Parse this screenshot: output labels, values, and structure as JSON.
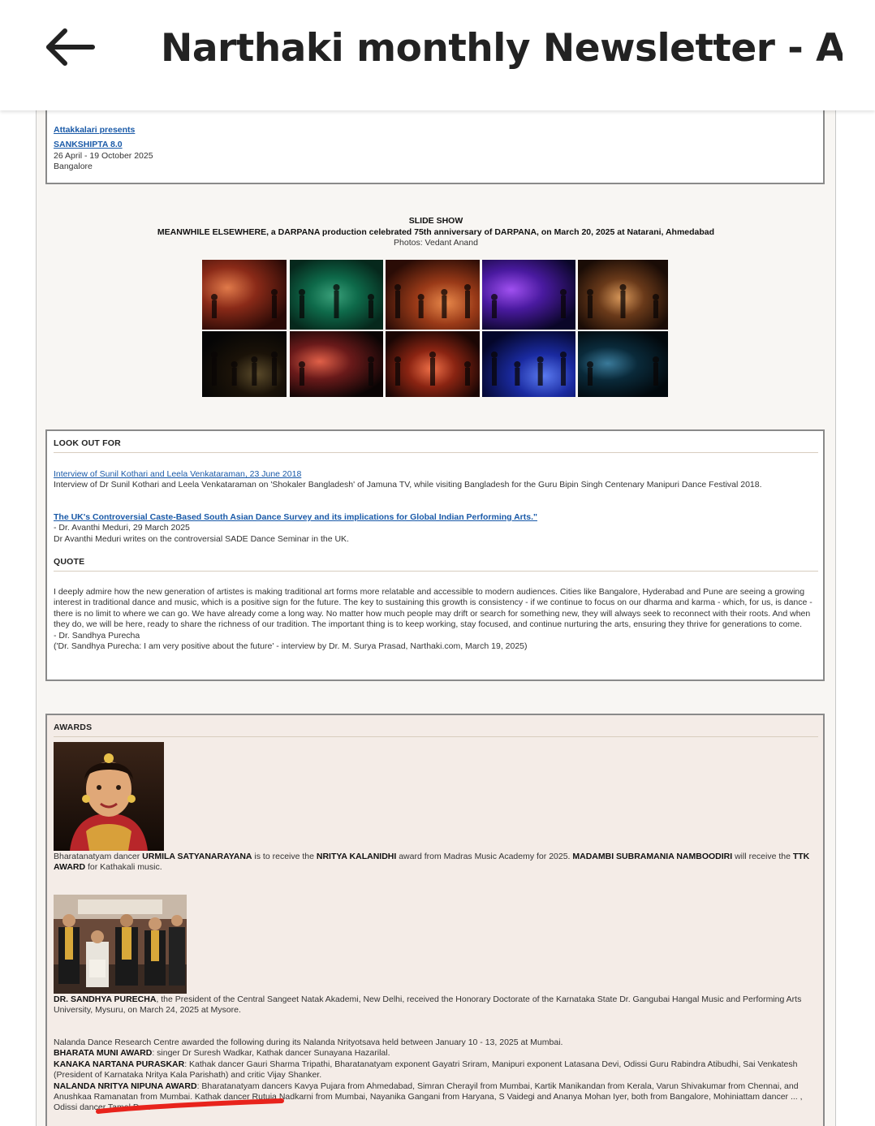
{
  "header": {
    "back_icon": "arrow-left-icon",
    "title": "Narthaki monthly Newsletter - Ap..."
  },
  "event": {
    "presenter": "Attakkalari presents",
    "name": "SANKSHIPTA 8.0",
    "dates": "26 April - 19 October 2025",
    "city": "Bangalore"
  },
  "slideshow": {
    "heading": "SLIDE SHOW",
    "caption": "MEANWHILE ELSEWHERE, a DARPANA production celebrated 75th anniversary of DARPANA, on March 20, 2025 at Natarani, Ahmedabad",
    "credit": "Photos: Vedant Anand",
    "photo_count": 10,
    "photo_palettes": [
      [
        "#2a0a06",
        "#8a2a18",
        "#e07a4a"
      ],
      [
        "#06281c",
        "#0e6a4a",
        "#3aa07a"
      ],
      [
        "#2a0c06",
        "#9a3a18",
        "#e8884a"
      ],
      [
        "#0a0628",
        "#4a1aa0",
        "#a050f0"
      ],
      [
        "#1a0c06",
        "#6a3a1a",
        "#d8985a"
      ],
      [
        "#050505",
        "#1a1208",
        "#5a4a2a"
      ],
      [
        "#0a0404",
        "#6a1a1a",
        "#e06048"
      ],
      [
        "#1a0604",
        "#8a2412",
        "#f07048"
      ],
      [
        "#04062a",
        "#1a2aa0",
        "#5a7af0"
      ],
      [
        "#02080c",
        "#0a2a3a",
        "#3a7a9a"
      ]
    ]
  },
  "look_out": {
    "heading": "LOOK OUT FOR",
    "items": [
      {
        "link": "Interview of Sunil Kothari and Leela Venkataraman, 23 June 2018",
        "text": "Interview of Dr Sunil Kothari and Leela Venkataraman on 'Shokaler Bangladesh' of Jamuna TV, while visiting Bangladesh for the Guru Bipin Singh Centenary Manipuri Dance Festival 2018."
      },
      {
        "link": "The UK's Controversial Caste-Based South Asian Dance Survey and its implications for Global Indian Performing Arts.\"",
        "byline": "- Dr. Avanthi Meduri, 29 March 2025",
        "text": "Dr Avanthi Meduri writes on the controversial SADE Dance Seminar in the UK."
      }
    ]
  },
  "quote": {
    "heading": "QUOTE",
    "body": "I deeply admire how the new generation of artistes is making traditional art forms more relatable and accessible to modern audiences. Cities like Bangalore, Hyderabad and Pune are seeing a growing interest in traditional dance and music, which is a positive sign for the future. The key to sustaining this growth is consistency - if we continue to focus on our dharma and karma - which, for us, is dance - there is no limit to where we can go. We have already come a long way. No matter how much people may drift or search for something new, they will always seek to reconnect with their roots. And when they do, we will be here, ready to share the richness of our tradition. The important thing is to keep working, stay focused, and continue nurturing the arts, ensuring they thrive for generations to come.",
    "author": "- Dr. Sandhya Purecha",
    "source": "('Dr. Sandhya Purecha: I am very positive about the future' - interview by Dr. M. Surya Prasad, Narthaki.com, March 19, 2025)"
  },
  "awards": {
    "heading": "AWARDS",
    "a1": {
      "t1": "Bharatanatyam dancer ",
      "b1": "URMILA SATYANARAYANA",
      "t2": " is to receive the ",
      "b2": "NRITYA KALANIDHI",
      "t3": " award from Madras Music Academy for 2025. ",
      "b3": "MADAMBI SUBRAMANIA NAMBOODIRI",
      "t4": " will receive the ",
      "b4": "TTK AWARD",
      "t5": " for Kathakali music."
    },
    "a2": {
      "b1": "DR. SANDHYA PURECHA",
      "t1": ", the President of the Central Sangeet Natak Akademi, New Delhi, received the Honorary Doctorate of the Karnataka State Dr. Gangubai Hangal Music and Performing Arts University, Mysuru, on March 24, 2025 at Mysore."
    },
    "nalanda": {
      "intro": "Nalanda Dance Research Centre awarded the following during its Nalanda Nrityotsava held between January 10 - 13, 2025 at Mumbai.",
      "l1b": "BHARATA MUNI AWARD",
      "l1t": ": singer Dr Suresh Wadkar, Kathak dancer Sunayana Hazarilal.",
      "l2b": "KANAKA NARTANA PURASKAR",
      "l2t": ": Kathak dancer Gauri Sharma Tripathi, Bharatanatyam exponent Gayatri Sriram, Manipuri exponent Latasana Devi, Odissi Guru Rabindra Atibudhi, Sai Venkatesh (President of Karnataka Nritya Kala Parishath) and critic Vijay Shanker.",
      "l3b": "NALANDA NRITYA NIPUNA AWARD",
      "l3t": ": Bharatanatyam dancers Kavya Pujara from Ahmedabad, Simran Cherayil from Mumbai, Kartik Manikandan from Kerala, Varun Shivakumar from Chennai, and Anushkaa Ramanatan from Mumbai. Kathak dancer Rutuja Nadkarni from Mumbai, Nayanika Gangani from Haryana, S Vaidegi and Ananya Mohan Iyer, both from Bangalore, Mohiniattam dancer ... , Odissi dancer Tamal Das."
    }
  },
  "colors": {
    "link": "#1a5aa8",
    "awards_bg": "#f4ece7",
    "annotation": "#e8231c"
  }
}
